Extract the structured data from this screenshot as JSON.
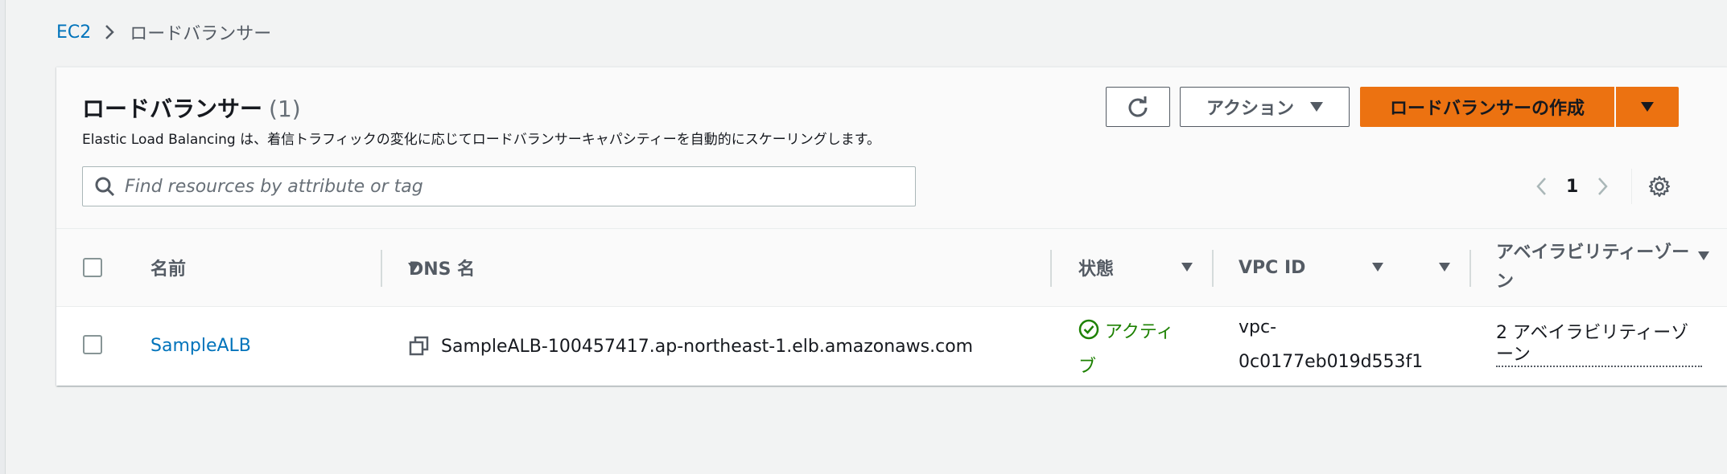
{
  "breadcrumb": {
    "root": "EC2",
    "current": "ロードバランサー"
  },
  "panel": {
    "title": "ロードバランサー",
    "count": "(1)",
    "description": "Elastic Load Balancing は、着信トラフィックの変化に応じてロードバランサーキャパシティーを自動的にスケーリングします。"
  },
  "toolbar": {
    "refresh_icon": "refresh-icon",
    "actions_label": "アクション",
    "create_label": "ロードバランサーの作成"
  },
  "search": {
    "placeholder": "Find resources by attribute or tag",
    "value": ""
  },
  "pagination": {
    "current_page": "1"
  },
  "table": {
    "columns": [
      "名前",
      "DNS 名",
      "状態",
      "VPC ID",
      "アベイラビリティーゾーン"
    ],
    "rows": [
      {
        "name": "SampleALB",
        "dns": "SampleALB-100457417.ap-northeast-1.elb.amazonaws.com",
        "state_line1": "アクティ",
        "state_line2": "ブ",
        "vpc_line1": "vpc-",
        "vpc_line2": "0c0177eb019d553f1",
        "az": "2 アベイラビリティーゾーン"
      }
    ]
  },
  "colors": {
    "primary": "#ec7211",
    "link": "#0073bb",
    "success": "#1d8102"
  }
}
